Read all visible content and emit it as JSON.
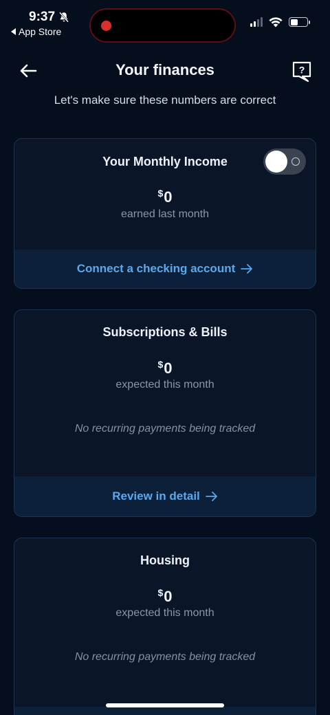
{
  "status_bar": {
    "time": "9:37",
    "back_app": "App Store",
    "icons": [
      "bell-slash-icon",
      "signal-icon",
      "wifi-icon",
      "battery-icon"
    ]
  },
  "header": {
    "title": "Your finances",
    "subtitle": "Let's make sure these numbers are correct",
    "back_icon": "arrow-left-icon",
    "help_icon": "help-chat-icon"
  },
  "cards": [
    {
      "title": "Your Monthly Income",
      "currency": "$",
      "amount": "0",
      "amount_label": "earned last month",
      "toggle_on": false,
      "footer_link": "Connect a checking account"
    },
    {
      "title": "Subscriptions & Bills",
      "currency": "$",
      "amount": "0",
      "amount_label": "expected this month",
      "empty_note": "No recurring payments being tracked",
      "footer_link": "Review in detail"
    },
    {
      "title": "Housing",
      "currency": "$",
      "amount": "0",
      "amount_label": "expected this month",
      "empty_note": "No recurring payments being tracked"
    }
  ],
  "colors": {
    "background": "#050e1d",
    "card": "#0a1628",
    "card_footer": "#0c2039",
    "link": "#5aa8ee",
    "record_dot": "#d9302c"
  }
}
